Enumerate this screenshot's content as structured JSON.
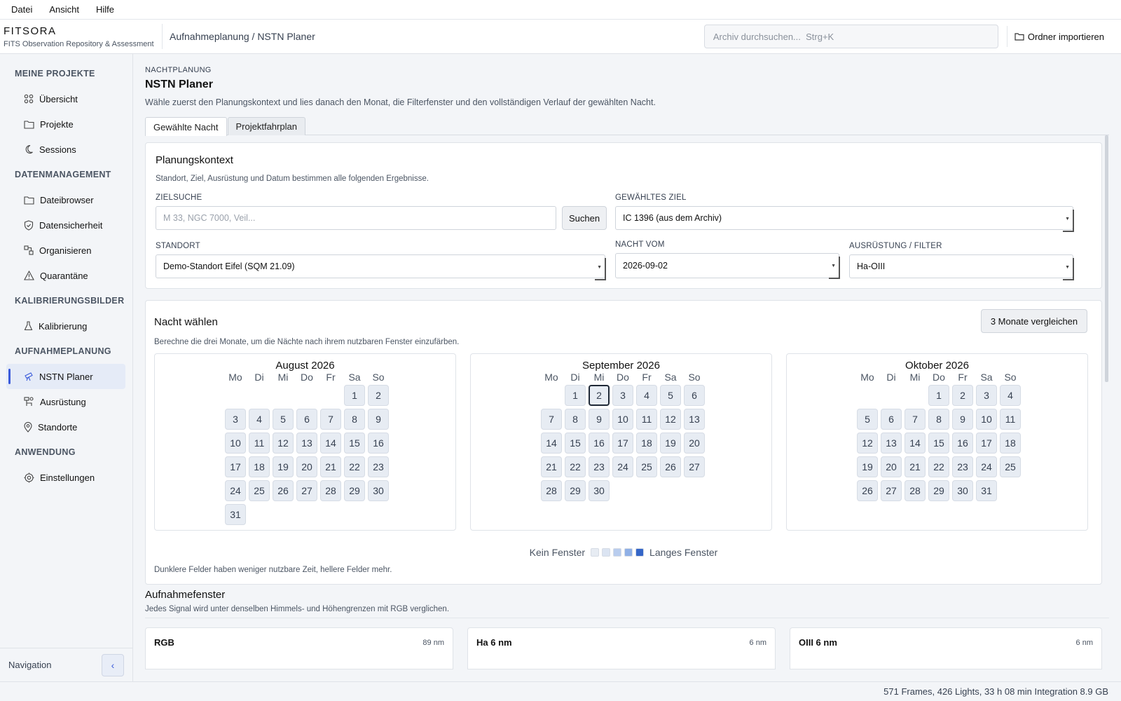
{
  "menu": [
    "Datei",
    "Ansicht",
    "Hilfe"
  ],
  "brand": {
    "name": "FITSORA",
    "subtitle": "FITS Observation Repository & Assessment"
  },
  "breadcrumb": "Aufnahmeplanung / NSTN Planer",
  "search": {
    "placeholder": "Archiv durchsuchen...  Strg+K"
  },
  "import_label": "Ordner importieren",
  "sidebar": {
    "sections": [
      {
        "title": "MEINE PROJEKTE",
        "items": [
          {
            "label": "Übersicht",
            "icon": "grid-icon"
          },
          {
            "label": "Projekte",
            "icon": "folder-icon"
          },
          {
            "label": "Sessions",
            "icon": "moon-icon"
          }
        ]
      },
      {
        "title": "DATENMANAGEMENT",
        "items": [
          {
            "label": "Dateibrowser",
            "icon": "folder-icon"
          },
          {
            "label": "Datensicherheit",
            "icon": "shield-icon"
          },
          {
            "label": "Organisieren",
            "icon": "organize-icon"
          },
          {
            "label": "Quarantäne",
            "icon": "warning-icon"
          }
        ]
      },
      {
        "title": "KALIBRIERUNGSBILDER",
        "items": [
          {
            "label": "Kalibrierung",
            "icon": "flask-icon"
          }
        ]
      },
      {
        "title": "AUFNAHMEPLANUNG",
        "items": [
          {
            "label": "NSTN Planer",
            "icon": "telescope-icon",
            "active": true
          },
          {
            "label": "Ausrüstung",
            "icon": "equipment-icon"
          },
          {
            "label": "Standorte",
            "icon": "pin-icon"
          }
        ]
      },
      {
        "title": "ANWENDUNG",
        "items": [
          {
            "label": "Einstellungen",
            "icon": "gear-icon"
          }
        ]
      }
    ],
    "footer_label": "Navigation",
    "collapse_glyph": "‹"
  },
  "page": {
    "eyebrow": "NACHTPLANUNG",
    "title": "NSTN Planer",
    "description": "Wähle zuerst den Planungskontext und lies danach den Monat, die Filterfenster und den vollständigen Verlauf der gewählten Nacht.",
    "tabs": [
      "Gewählte Nacht",
      "Projektfahrplan"
    ]
  },
  "context": {
    "title": "Planungskontext",
    "description": "Standort, Ziel, Ausrüstung und Datum bestimmen alle folgenden Ergebnisse.",
    "target_search_label": "ZIELSUCHE",
    "target_search_placeholder": "M 33, NGC 7000, Veil...",
    "search_button": "Suchen",
    "selected_target_label": "GEWÄHLTES ZIEL",
    "selected_target_value": "IC 1396  (aus dem Archiv)",
    "site_label": "STANDORT",
    "site_value": "Demo-Standort Eifel  (SQM 21.09)",
    "night_label": "NACHT VOM",
    "night_value": "2026-09-02",
    "equipment_label": "AUSRÜSTUNG / FILTER",
    "equipment_value": "Ha-OIII"
  },
  "night": {
    "title": "Nacht wählen",
    "description": "Berechne die drei Monate, um die Nächte nach ihrem nutzbaren Fenster einzufärben.",
    "compare_button": "3 Monate vergleichen",
    "weekdays": [
      "Mo",
      "Di",
      "Mi",
      "Do",
      "Fr",
      "Sa",
      "So"
    ],
    "months": [
      {
        "name": "August 2026",
        "offset": 5,
        "days": 31
      },
      {
        "name": "September 2026",
        "offset": 1,
        "days": 30,
        "selected": 2
      },
      {
        "name": "Oktober 2026",
        "offset": 3,
        "days": 31
      }
    ],
    "legend_left": "Kein Fenster",
    "legend_right": "Langes Fenster",
    "legend_colors": [
      "#e7ecf3",
      "#dbe4f2",
      "#b9cdee",
      "#8fb0e6",
      "#3566c8"
    ],
    "note": "Dunklere Felder haben weniger nutzbare Zeit, hellere Felder mehr."
  },
  "windows": {
    "title": "Aufnahmefenster",
    "description": "Jedes Signal wird unter denselben Himmels- und Höhengrenzen mit RGB verglichen.",
    "cards": [
      {
        "name": "RGB",
        "bandwidth": "89 nm"
      },
      {
        "name": "Ha 6 nm",
        "bandwidth": "6 nm"
      },
      {
        "name": "OIII 6 nm",
        "bandwidth": "6 nm"
      }
    ]
  },
  "status": "571 Frames, 426 Lights, 33 h 08 min Integration  8.9 GB"
}
